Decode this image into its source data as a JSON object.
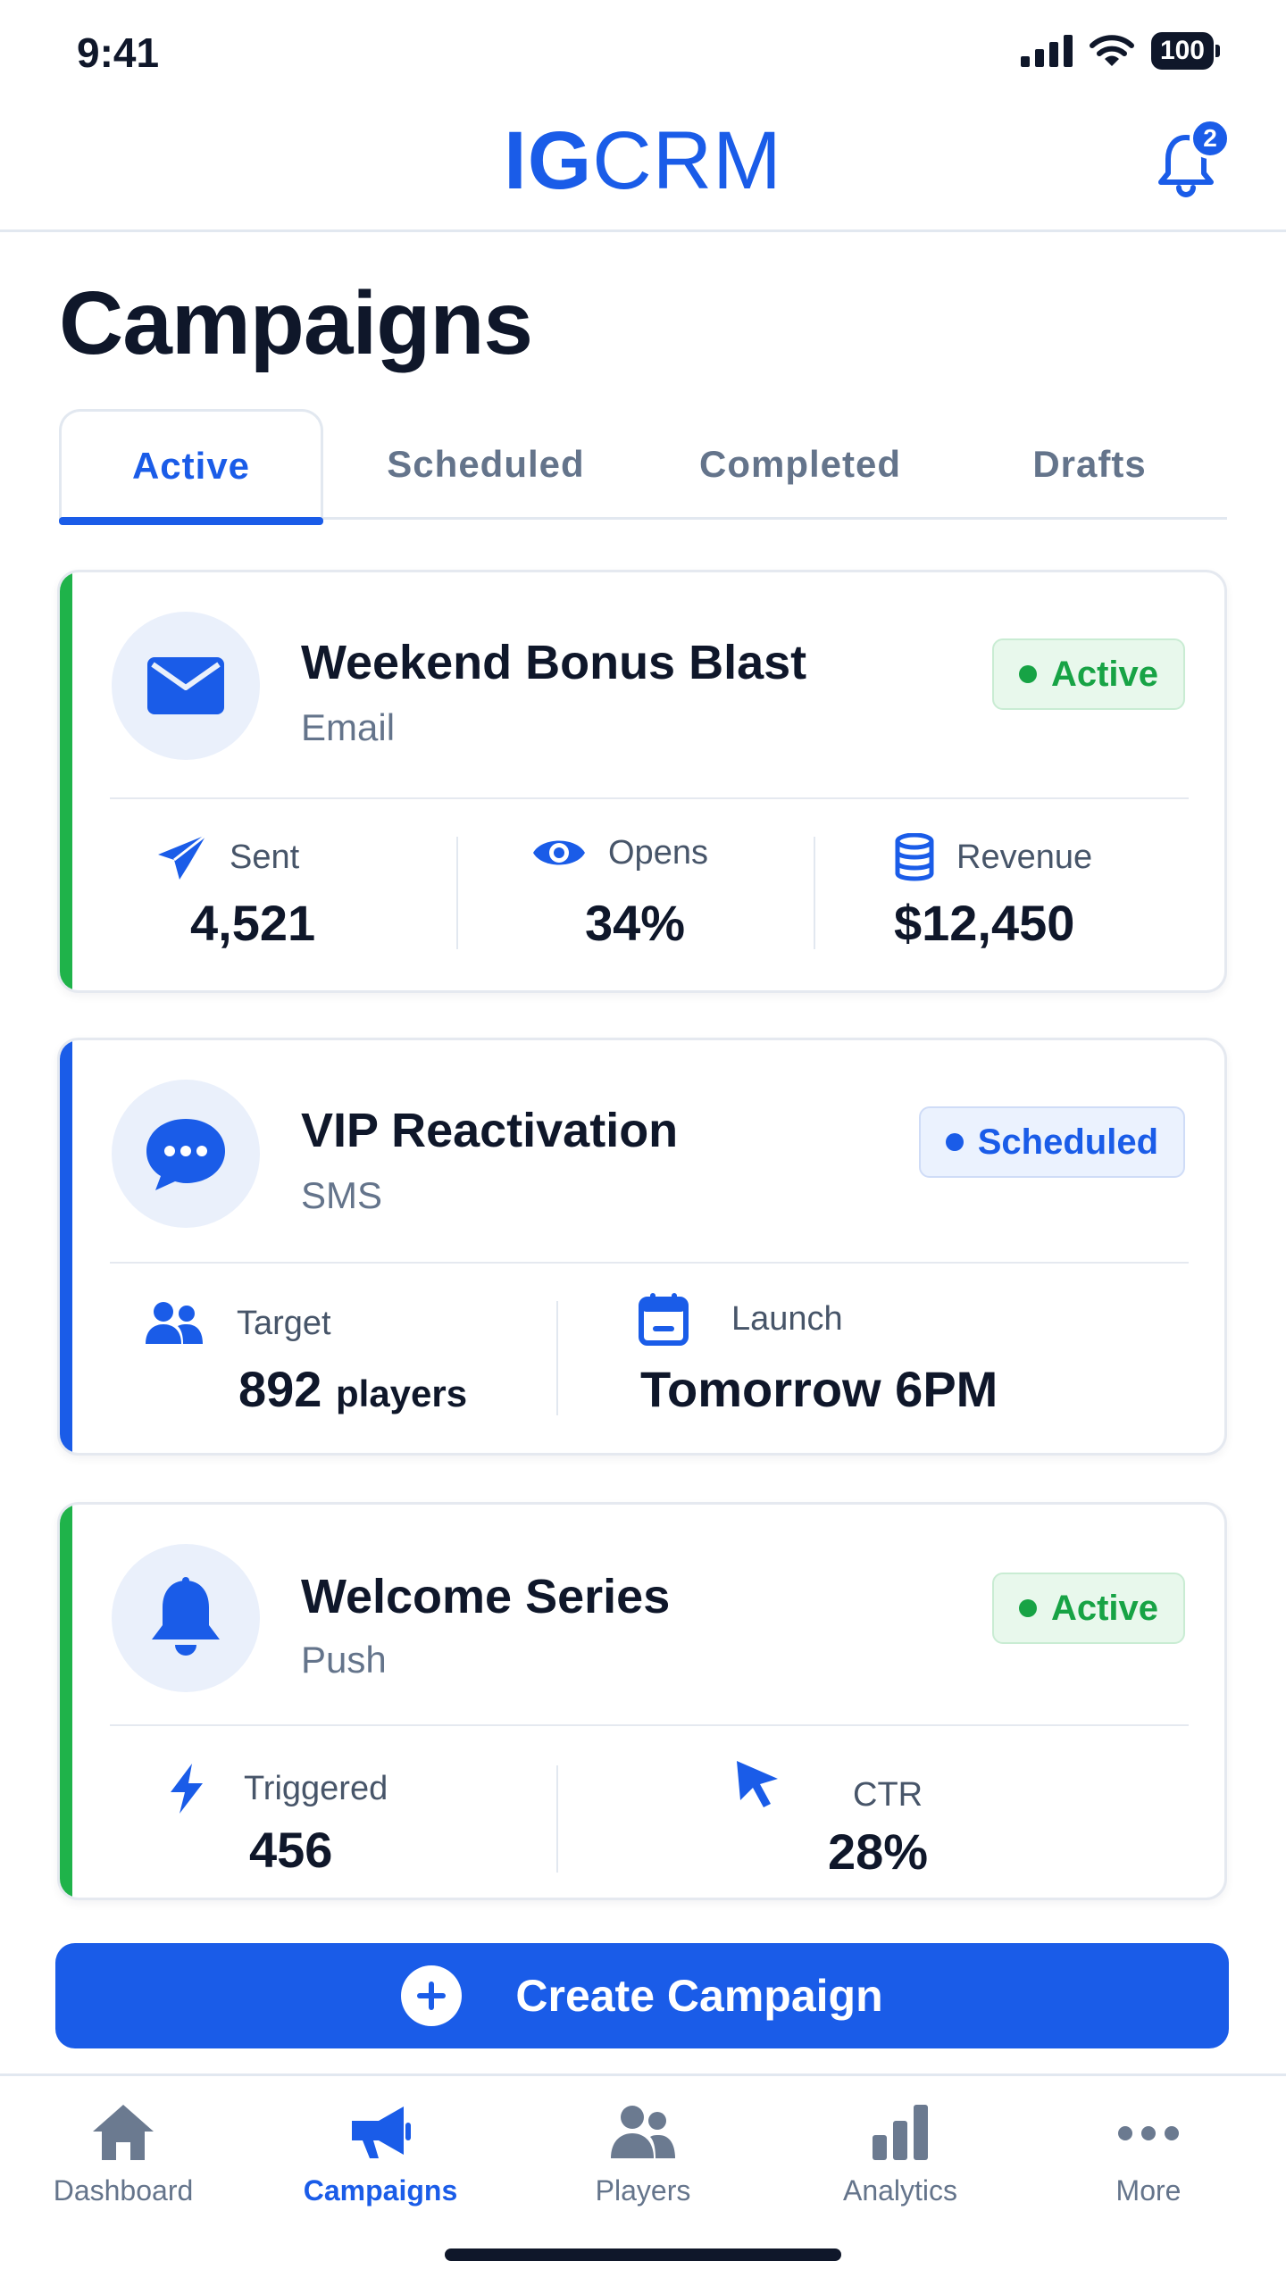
{
  "status_bar": {
    "time": "9:41",
    "battery": "100"
  },
  "header": {
    "logo_bold": "IG",
    "logo_light": "CRM",
    "notification_count": "2"
  },
  "page": {
    "title": "Campaigns"
  },
  "tabs": [
    {
      "label": "Active",
      "active": true
    },
    {
      "label": "Scheduled",
      "active": false
    },
    {
      "label": "Completed",
      "active": false
    },
    {
      "label": "Drafts",
      "active": false
    }
  ],
  "campaigns": [
    {
      "title": "Weekend Bonus Blast",
      "channel": "Email",
      "status": "Active",
      "icon": "envelope-icon",
      "accent": "#1fb34a",
      "stats": [
        {
          "label": "Sent",
          "value": "4,521",
          "icon": "paper-plane-icon"
        },
        {
          "label": "Opens",
          "value": "34%",
          "icon": "eye-icon"
        },
        {
          "label": "Revenue",
          "value": "$12,450",
          "icon": "coins-icon"
        }
      ]
    },
    {
      "title": "VIP Reactivation",
      "channel": "SMS",
      "status": "Scheduled",
      "icon": "chat-bubble-icon",
      "accent": "#1a5ce8",
      "stats": [
        {
          "label": "Target",
          "value": "892",
          "unit": "players",
          "icon": "users-icon"
        },
        {
          "label": "Launch",
          "value": "Tomorrow 6PM",
          "icon": "calendar-icon"
        }
      ]
    },
    {
      "title": "Welcome Series",
      "channel": "Push",
      "status": "Active",
      "icon": "bell-icon",
      "accent": "#1fb34a",
      "stats": [
        {
          "label": "Triggered",
          "value": "456",
          "icon": "lightning-icon"
        },
        {
          "label": "CTR",
          "value": "28%",
          "icon": "cursor-icon"
        }
      ]
    }
  ],
  "cta": {
    "label": "Create Campaign"
  },
  "bottom_nav": [
    {
      "label": "Dashboard",
      "icon": "home-icon",
      "active": false
    },
    {
      "label": "Campaigns",
      "icon": "megaphone-icon",
      "active": true
    },
    {
      "label": "Players",
      "icon": "players-icon",
      "active": false
    },
    {
      "label": "Analytics",
      "icon": "bar-chart-icon",
      "active": false
    },
    {
      "label": "More",
      "icon": "more-icon",
      "active": false
    }
  ],
  "colors": {
    "brand_blue": "#1a5ce8",
    "active_green": "#1fb34a",
    "text_dark": "#0f172a",
    "text_muted": "#64748b"
  }
}
